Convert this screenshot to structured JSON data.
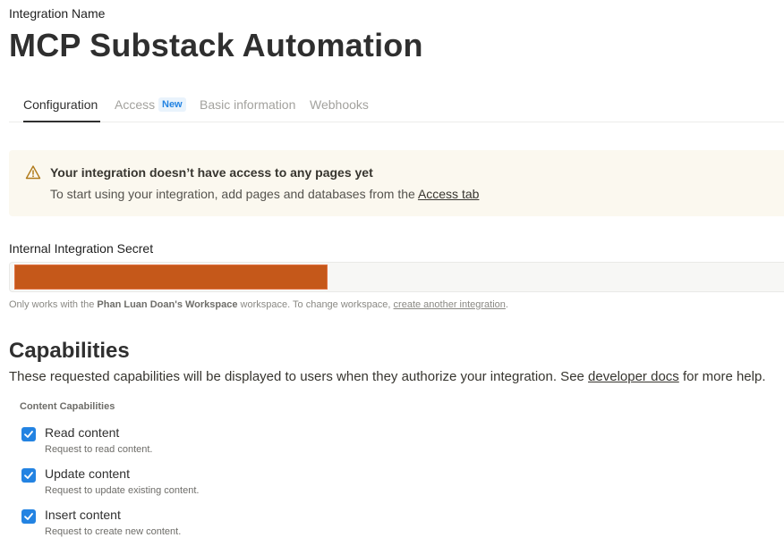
{
  "header": {
    "integration_label": "Integration Name",
    "integration_name": "MCP Substack Automation"
  },
  "tabs": [
    {
      "label": "Configuration",
      "active": true
    },
    {
      "label": "Access",
      "badge": "New"
    },
    {
      "label": "Basic information"
    },
    {
      "label": "Webhooks"
    }
  ],
  "alert": {
    "icon": "warning-icon",
    "title": "Your integration doesn’t have access to any pages yet",
    "body_prefix": "To start using your integration, add pages and databases from the ",
    "link": "Access tab"
  },
  "secret": {
    "label": "Internal Integration Secret",
    "redacted_color": "#c5581a",
    "note_prefix": "Only works with the ",
    "workspace": "Phan Luan Doan's Workspace",
    "note_middle": " workspace. To change workspace, ",
    "note_link": "create another integration",
    "note_suffix": "."
  },
  "capabilities": {
    "title": "Capabilities",
    "desc_prefix": "These requested capabilities will be displayed to users when they authorize your integration. See ",
    "desc_link": "developer docs",
    "desc_suffix": " for more help.",
    "section_label": "Content Capabilities",
    "items": [
      {
        "name": "Read content",
        "description": "Request to read content.",
        "checked": true
      },
      {
        "name": "Update content",
        "description": "Request to update existing content.",
        "checked": true
      },
      {
        "name": "Insert content",
        "description": "Request to create new content.",
        "checked": true
      }
    ]
  },
  "colors": {
    "accent": "#2383e2",
    "alert_bg": "#fbf8ef"
  }
}
